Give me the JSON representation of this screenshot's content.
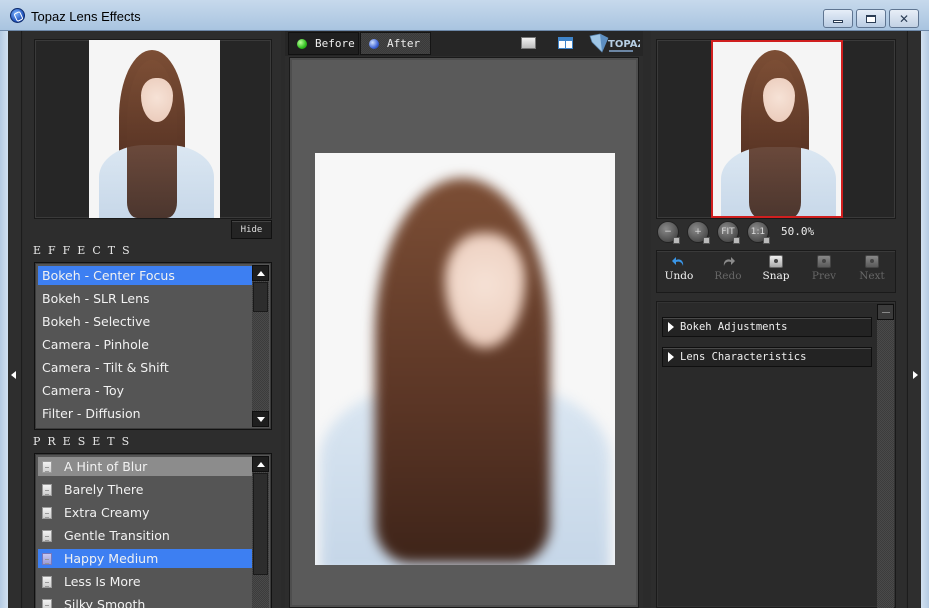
{
  "window": {
    "title": "Topaz Lens Effects",
    "controls": [
      "minimize",
      "maximize",
      "close"
    ]
  },
  "left_panel": {
    "hide_button": "Hide",
    "effects": {
      "label": "EFFECTS",
      "items": [
        "Bokeh - Center Focus",
        "Bokeh - SLR Lens",
        "Bokeh - Selective",
        "Camera - Pinhole",
        "Camera - Tilt & Shift",
        "Camera - Toy",
        "Filter - Diffusion"
      ],
      "selected": "Bokeh - Center Focus"
    },
    "presets": {
      "label": "PRESETS",
      "items": [
        "A Hint of Blur",
        "Barely There",
        "Extra Creamy",
        "Gentle Transition",
        "Happy Medium",
        "Less Is More",
        "Silky Smooth"
      ],
      "hovered": "A Hint of Blur",
      "selected": "Happy Medium"
    }
  },
  "center": {
    "tabs": [
      {
        "label": "Before",
        "icon": "green-dot-icon"
      },
      {
        "label": "After",
        "icon": "blue-dot-icon"
      }
    ],
    "active_tab": "After",
    "view_modes": [
      "single-view",
      "split-view"
    ],
    "logo": "TOPAZ"
  },
  "right_panel": {
    "zoom": {
      "buttons": [
        "zoom-out",
        "zoom-in",
        "FIT",
        "1:1"
      ],
      "fit_label": "FIT",
      "one_label": "1:1",
      "level": "50.0%"
    },
    "toolbar": {
      "undo": "Undo",
      "redo": "Redo",
      "snap": "Snap",
      "prev": "Prev",
      "next": "Next"
    },
    "sections": [
      "Bokeh Adjustments",
      "Lens Characteristics"
    ]
  },
  "colors": {
    "selection": "#3d7ff2",
    "preview_border": "#d01f1f",
    "panel_bg": "#2d2d2d",
    "canvas_bg": "#5a5a5a"
  }
}
